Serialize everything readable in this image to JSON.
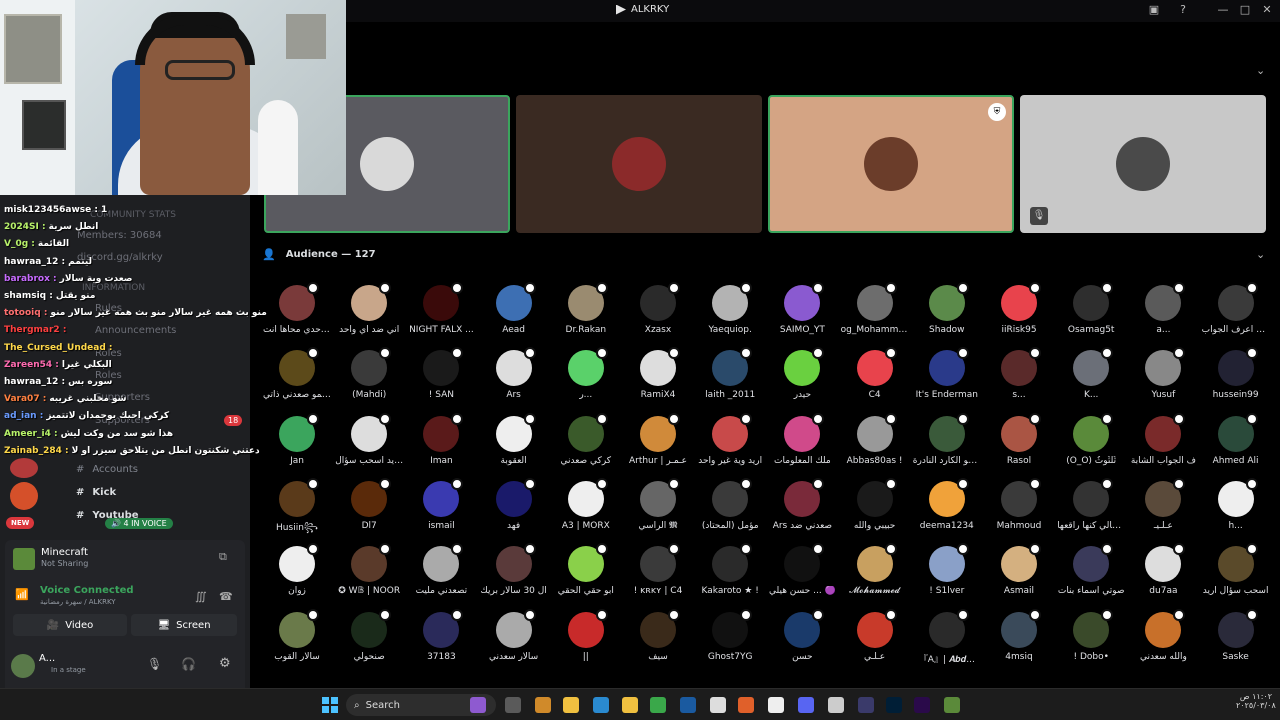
{
  "window": {
    "title": "ALKRKY"
  },
  "stage": {
    "audience_label": "Audience — 127",
    "speakers": [
      {
        "color": "#5a5a60",
        "avatar": "#d9d9d9"
      },
      {
        "color": "#3a2a22",
        "avatar": "#8b2a2a"
      },
      {
        "color": "#d4a484",
        "avatar": "#6b3d2a"
      },
      {
        "color": "#c8c8c8",
        "avatar": "#4a4a4a"
      }
    ]
  },
  "members": [
    [
      "وأنا احدي محاها أنت",
      "#7a3a3a"
    ],
    [
      "اني ضد اي واحد",
      "#c8a68a"
    ],
    [
      "NIGHT FALX ...",
      "#3a0a0a"
    ],
    [
      "Aead",
      "#3d6fb3"
    ],
    [
      "Dr.Rakan",
      "#9a8b70"
    ],
    [
      "Xzasx",
      "#2a2a2a"
    ],
    [
      "Yaequiop.",
      "#b3b3b3"
    ],
    [
      "SAIMO_YT",
      "#8a5ad0"
    ],
    [
      "og_Mohammed",
      "#6d6d6d"
    ],
    [
      "Shadow",
      "#5b8a4a"
    ],
    [
      "iiRisk95",
      "#e8434c"
    ],
    [
      "Osamag5t",
      "#2e2e2e"
    ],
    [
      "a...",
      "#5a5a5a"
    ],
    [
      "والله اعرف الجواب",
      "#3a3a3a"
    ],
    [
      "عمو صعدني ذاتي !",
      "#5c4a1a"
    ],
    [
      "(Mahdi)",
      "#3a3a3a"
    ],
    [
      "! SAN",
      "#1a1a1a"
    ],
    [
      "Ars",
      "#ddd"
    ],
    [
      "ر...",
      "#5ad16a"
    ],
    [
      "RamiX4",
      "#dddddd"
    ],
    [
      "laith _2011",
      "#2a4a6a"
    ],
    [
      "حيدر",
      "#6ad040"
    ],
    [
      "C4",
      "#e8434c"
    ],
    [
      "It's Enderman",
      "#2a3a8a"
    ],
    [
      "s...",
      "#5a2a2a"
    ],
    [
      "K...",
      "#6b6f78"
    ],
    [
      "Yusuf",
      "#888"
    ],
    [
      "hussein99",
      "#223"
    ],
    [
      "Jan",
      "#3ba55d"
    ],
    [
      "اريد اسحب سؤال ...",
      "#ddd"
    ],
    [
      "Iman",
      "#5a1a1a"
    ],
    [
      "العقوبة",
      "#eee"
    ],
    [
      "كركي صعدني",
      "#3a5a2a"
    ],
    [
      "Arthur | عـمـر",
      "#d08a3a"
    ],
    [
      "اريد وية غير واحد",
      "#c84a4a"
    ],
    [
      "ملك المعلومات",
      "#d04a8a"
    ],
    [
      "Abbas80as !",
      "#999"
    ],
    [
      "اني هو الكارد النادرة",
      "#3a5a3a"
    ],
    [
      "Rasol",
      "#aa5544"
    ],
    [
      "(Ö_Ö) ثُلثُوثُ",
      "#5a8a3a"
    ],
    [
      "ف الجواب الشابة",
      "#7a2a2a"
    ],
    [
      "Ahmed Ali",
      "#2a4a3a"
    ],
    [
      "Husiin꧂",
      "#5a3a1a"
    ],
    [
      "Dl7",
      "#5a2a0a"
    ],
    [
      "ismail",
      "#3a3ab0"
    ],
    [
      "فهد",
      "#1a1a6a"
    ],
    [
      "A3 | MORX",
      "#eee"
    ],
    [
      "الراسي 𝕸",
      "#666"
    ],
    [
      "مؤمل (المحتاد)",
      "#3a3a3a"
    ],
    [
      "Ars صعدني ضد",
      "#7a2a3a"
    ],
    [
      "حبيبي والله",
      "#1a1a1a"
    ],
    [
      "deema1234",
      "#f0a23a"
    ],
    [
      "Mahmoud",
      "#3a3a3a"
    ],
    [
      "وجحالي كنها راقعها",
      "#333"
    ],
    [
      "عـلـيـ",
      "#5a4a3a"
    ],
    [
      "h...",
      "#eee"
    ],
    [
      "زوان",
      "#eee"
    ],
    [
      "✪ W𝔹 | NOOR",
      "#5a3a2a"
    ],
    [
      "تصعدني مليت",
      "#aaa"
    ],
    [
      "ال 30 سالار بريك",
      "#5a3a3a"
    ],
    [
      "أبو حقي الحقي",
      "#8ad04a"
    ],
    [
      "! ᴋʀᴋʏ | C4",
      "#3a3a3a"
    ],
    [
      "Kakaroto ★ !",
      "#2a2a2a"
    ],
    [
      "حسن هيلي ... 🟣",
      "#111"
    ],
    [
      "𝓜𝓸𝓱𝓪𝓶𝓶𝓮𝓭",
      "#c8a060"
    ],
    [
      "! S1lver",
      "#8aa0c8"
    ],
    [
      "Asmail",
      "#d4b080"
    ],
    [
      "صوتي أسماء بنات",
      "#3a3a5a"
    ],
    [
      "du7aa",
      "#ddd"
    ],
    [
      "اسحب سؤال اريد",
      "#5a4a2a"
    ],
    [
      "سالار القوب",
      "#6a7a4a"
    ],
    [
      "صنحولي",
      "#1a2a1a"
    ],
    [
      "37183",
      "#2a2a5a"
    ],
    [
      "سالار سعدني",
      "#aaa"
    ],
    [
      "||",
      "#c82a2a"
    ],
    [
      "سيف",
      "#3a2a1a"
    ],
    [
      "Ghost7YG",
      "#111"
    ],
    [
      "حسن",
      "#1a3a6a"
    ],
    [
      "عـلـي",
      "#c83a2a"
    ],
    [
      "『A』| 𝑨𝒃𝒅...",
      "#2a2a2a"
    ],
    [
      "4msiq",
      "#3a4a5a"
    ],
    [
      "! Dobo•",
      "#3a4a2a"
    ],
    [
      "والله سعدني",
      "#c8702a"
    ],
    [
      "Saske",
      "#2a2a3a"
    ]
  ],
  "chat": [
    [
      "misk123456awse :",
      "1",
      "#ffffff"
    ],
    [
      "2024SI :",
      "انطل سرية",
      "#b8f26a"
    ],
    [
      "V_0g :",
      "القائمة",
      "#b8f26a"
    ],
    [
      "hawraa_12 :",
      "ليتمم",
      "#ffffff"
    ],
    [
      "barabrox :",
      "صعدت وية سالار",
      "#c76bff"
    ],
    [
      "shamsiq :",
      "منو يقتل",
      "#ffffff"
    ],
    [
      "totooiq :",
      "منو بث همه غير سالار منو بث همه غير سالار منو",
      "#ff7070"
    ],
    [
      "Thergmar2 :",
      "",
      "#ff4040"
    ],
    [
      "The_Cursed_Undead :",
      "",
      "#ffd84a"
    ],
    [
      "Zareen54 :",
      "البكلي غيرا",
      "#ff6bb0"
    ],
    [
      "hawraa_12 :",
      "سوره بس",
      "#ffffff"
    ],
    [
      "Vara07 :",
      "شو مخلبني غريبه",
      "#ff8040"
    ],
    [
      "ad_ian :",
      "كركي احبك بوحمدان لاتتميز",
      "#6a9bff"
    ],
    [
      "Ameer_i4 :",
      "هذا شو سد من وكت ليش",
      "#b8f26a"
    ],
    [
      "Zainab_284 :",
      "دعتني شكنتون انطل من يتلاحق سيزر او لا",
      "#ffd84a"
    ]
  ],
  "sidebar": {
    "community_stats": "COMMUNITY STATS",
    "members": "Members: 30684",
    "invite": "discord.gg/alkrky",
    "information": "INFORMATION",
    "rules": "Rules",
    "announcements": "Announcements",
    "roles_prefix": "Roles",
    "roles": "Roles",
    "supporters_prefix": "Supporters",
    "supporters": "Supporters",
    "supporters_count": "18",
    "accounts": "Accounts",
    "kick": "Kick",
    "youtube": "Youtube",
    "in_voice": "4 IN VOICE",
    "new_badge": "NEW"
  },
  "voice": {
    "activity_title": "Minecraft",
    "activity_sub": "Not Sharing",
    "status": "Voice Connected",
    "channel": "سهرة رمضانية / ALKRKY",
    "video_label": "Video",
    "screen_label": "Screen"
  },
  "user": {
    "name": "A...",
    "status": "In a stage"
  },
  "taskbar": {
    "search_placeholder": "Search",
    "time": "١١:٠٢ ص",
    "date": "٢٠٢٥/٠٣/٠٨"
  }
}
